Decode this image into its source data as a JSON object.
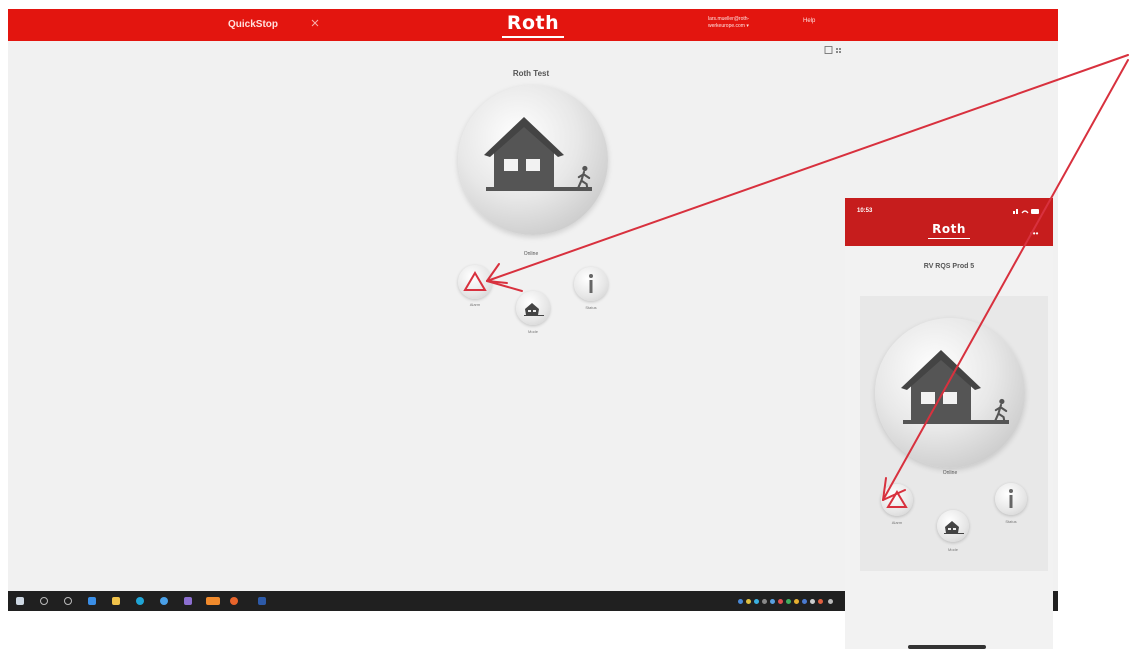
{
  "desktop": {
    "nav": {
      "quickstop": "QuickStop",
      "user_email_line1": "lars.mueller@roth-",
      "user_email_line2": "werkeurope.com ▾",
      "help": "Help"
    },
    "logo": "Roth",
    "device_title": "Roth Test",
    "status": "Online",
    "buttons": {
      "alarm": "Alarm",
      "mode": "Mode",
      "status": "Status"
    }
  },
  "phone": {
    "time": "10:53",
    "logo": "Roth",
    "more": "•••",
    "device_title": "RV RQS Prod 5",
    "status": "Online",
    "buttons": {
      "alarm": "Alarm",
      "mode": "Mode",
      "status": "Status"
    }
  },
  "colors": {
    "brand_red": "#e3150f",
    "phone_red": "#c61d1d",
    "arrow_red": "#d8313e",
    "taskbar": "#202020"
  },
  "icons": [
    "house-icon",
    "person-walking-icon",
    "alarm-triangle-icon",
    "info-icon",
    "menu-icon",
    "view-toggle-icon"
  ]
}
